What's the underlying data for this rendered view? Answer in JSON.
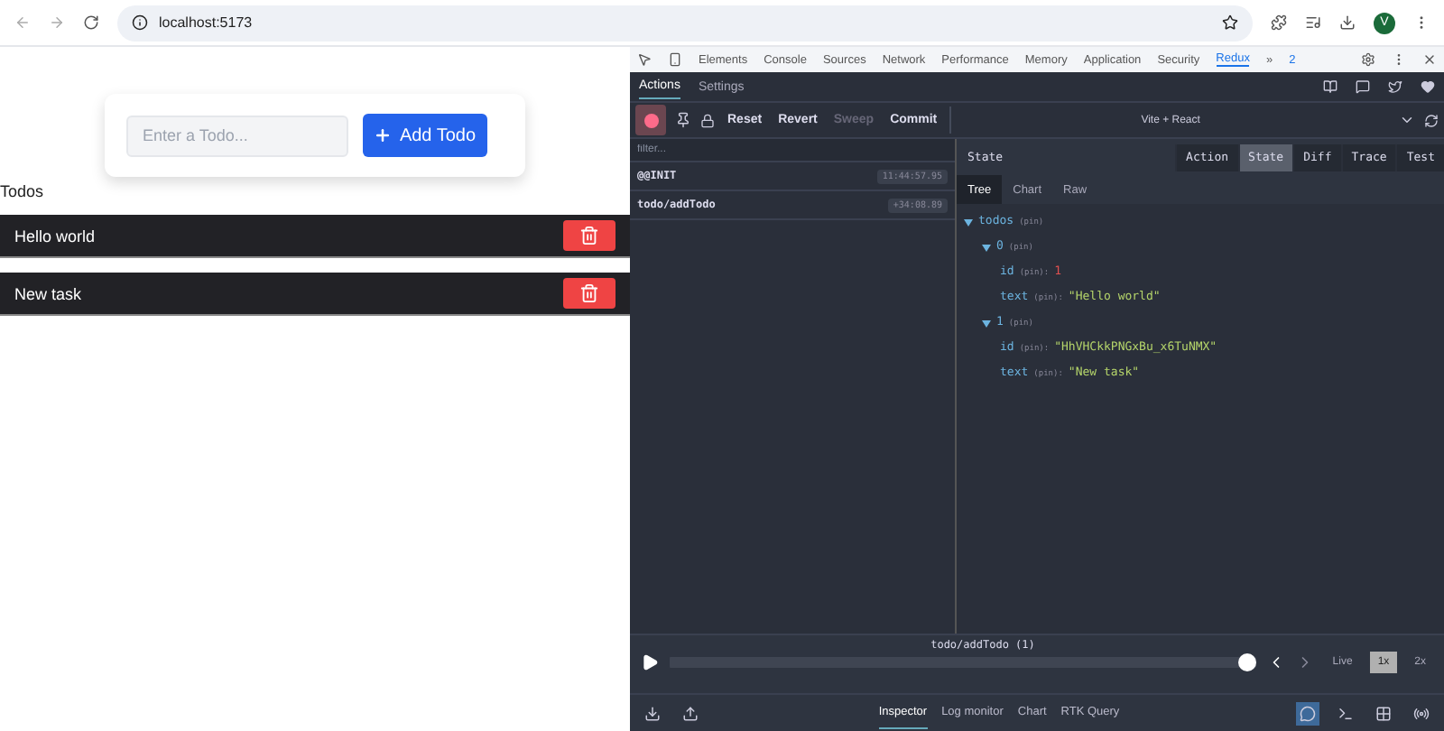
{
  "browser": {
    "url": "localhost:5173",
    "profile_initial": "V"
  },
  "page": {
    "input": {
      "placeholder": "Enter a Todo..."
    },
    "add_button": "Add Todo",
    "heading": "Todos",
    "todos": [
      {
        "text": "Hello world"
      },
      {
        "text": "New task"
      }
    ]
  },
  "devtools": {
    "tabs": [
      {
        "label": "Elements",
        "selected": false
      },
      {
        "label": "Console",
        "selected": false
      },
      {
        "label": "Sources",
        "selected": false
      },
      {
        "label": "Network",
        "selected": false
      },
      {
        "label": "Performance",
        "selected": false
      },
      {
        "label": "Memory",
        "selected": false
      },
      {
        "label": "Application",
        "selected": false
      },
      {
        "label": "Security",
        "selected": false
      },
      {
        "label": "Redux",
        "selected": true
      }
    ],
    "more": "»",
    "issues_count": "2",
    "redux": {
      "tabs": [
        {
          "label": "Actions",
          "selected": true
        },
        {
          "label": "Settings",
          "selected": false
        }
      ],
      "toolbar": [
        {
          "label": "Reset",
          "disabled": false
        },
        {
          "label": "Revert",
          "disabled": false
        },
        {
          "label": "Sweep",
          "disabled": true
        },
        {
          "label": "Commit",
          "disabled": false
        }
      ],
      "instance": "Vite + React",
      "filter": {
        "placeholder": "filter..."
      },
      "actions": [
        {
          "name": "@@INIT",
          "time": "11:44:57.95"
        },
        {
          "name": "todo/addTodo",
          "time": "+34:08.89"
        }
      ],
      "state_title": "State",
      "monitor_tabs": [
        {
          "label": "Action",
          "selected": false
        },
        {
          "label": "State",
          "selected": true
        },
        {
          "label": "Diff",
          "selected": false
        },
        {
          "label": "Trace",
          "selected": false
        },
        {
          "label": "Test",
          "selected": false
        }
      ],
      "view_tabs": [
        {
          "label": "Tree",
          "selected": true
        },
        {
          "label": "Chart",
          "selected": false
        },
        {
          "label": "Raw",
          "selected": false
        }
      ],
      "tree": [
        {
          "key": "todos",
          "tag": "(pin)",
          "expanded": true,
          "children": [
            {
              "key": "0",
              "tag": "(pin)",
              "expanded": true,
              "children": [
                {
                  "key": "id",
                  "tag": "(pin):",
                  "value": "1",
                  "kind": "number"
                },
                {
                  "key": "text",
                  "tag": "(pin):",
                  "value": "\"Hello world\"",
                  "kind": "string"
                }
              ]
            },
            {
              "key": "1",
              "tag": "(pin)",
              "expanded": true,
              "children": [
                {
                  "key": "id",
                  "tag": "(pin):",
                  "value": "\"HhVHCkkPNGxBu_x6TuNMX\"",
                  "kind": "string"
                },
                {
                  "key": "text",
                  "tag": "(pin):",
                  "value": "\"New task\"",
                  "kind": "string"
                }
              ]
            }
          ]
        }
      ],
      "slider": {
        "label": "todo/addTodo",
        "count": "(1)",
        "level": 1
      },
      "speeds": [
        {
          "label": "Live",
          "selected": false
        },
        {
          "label": "1x",
          "selected": true
        },
        {
          "label": "2x",
          "selected": false
        }
      ],
      "bottom_tabs": [
        {
          "label": "Inspector",
          "selected": true
        },
        {
          "label": "Log monitor",
          "selected": false
        },
        {
          "label": "Chart",
          "selected": false
        },
        {
          "label": "RTK Query",
          "selected": false
        }
      ]
    }
  }
}
